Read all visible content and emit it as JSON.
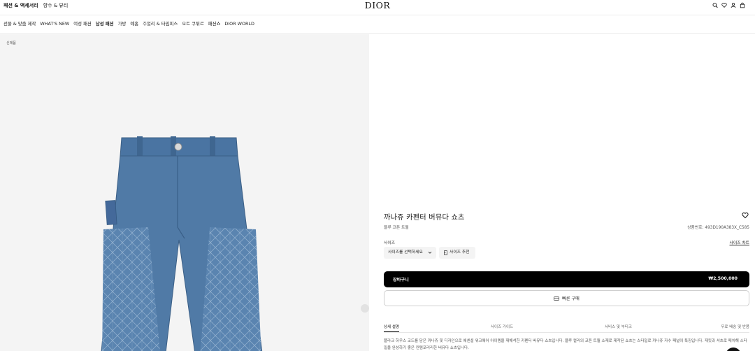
{
  "topbar": {
    "links": [
      "패션 & 액세서리",
      "향수 & 뷰티"
    ],
    "logo": "DIOR",
    "icons": [
      "search-icon",
      "heart-icon",
      "user-icon",
      "bag-icon"
    ]
  },
  "nav": {
    "items": [
      "선물 & 맞춤 제작",
      "WHAT'S NEW",
      "여성 패션",
      "남성 패션",
      "가방",
      "예홈",
      "주얼리 & 타임피스",
      "오트 쿠튀르",
      "패션쇼",
      "DIOR WORLD"
    ],
    "active_index": 3
  },
  "gallery": {
    "breadcrumb": "신제품",
    "image_alt": "denim-bermuda-shorts"
  },
  "product": {
    "title": "까나쥬 카펜터 버뮤다 쇼츠",
    "subtitle": "블루 코튼 트윌",
    "sku_label": "상품번호:",
    "sku_value": "493D190A383X_C585",
    "size_label": "사이즈",
    "size_guide": "사이즈 차트",
    "size_select_placeholder": "사이즈를 선택하세요",
    "size_recommend": "사이즈 추천",
    "cart_label": "장바구니",
    "price": "₩2,500,000",
    "quick_buy": "빠른 구매",
    "tabs": [
      "상세 설명",
      "사이즈 가이드",
      "서비스 및 부티크",
      "무료 배송 및 반품"
    ],
    "description": "플라크 하우스 코드를 담은 까나쥬 핏 디자인으로 에센셜 워크웨어 아이템을 재해석한 카펜터 버뮤다 쇼츠입니다. 블루 컬러의 코튼 트윌 소재로 제작된 쇼츠는 스타일로 까나쥬 자수 패널이 특징입니다. 재킷과 셔츠로 매치해 스타일을 완성하기 좋은 컨템포러리한 버뮤다 쇼츠입니다."
  },
  "colors": {
    "denim": "#4f79a6",
    "denim_dark": "#3a5f88",
    "panel_bg": "#f4f4f4",
    "cart_bg": "#000000"
  }
}
